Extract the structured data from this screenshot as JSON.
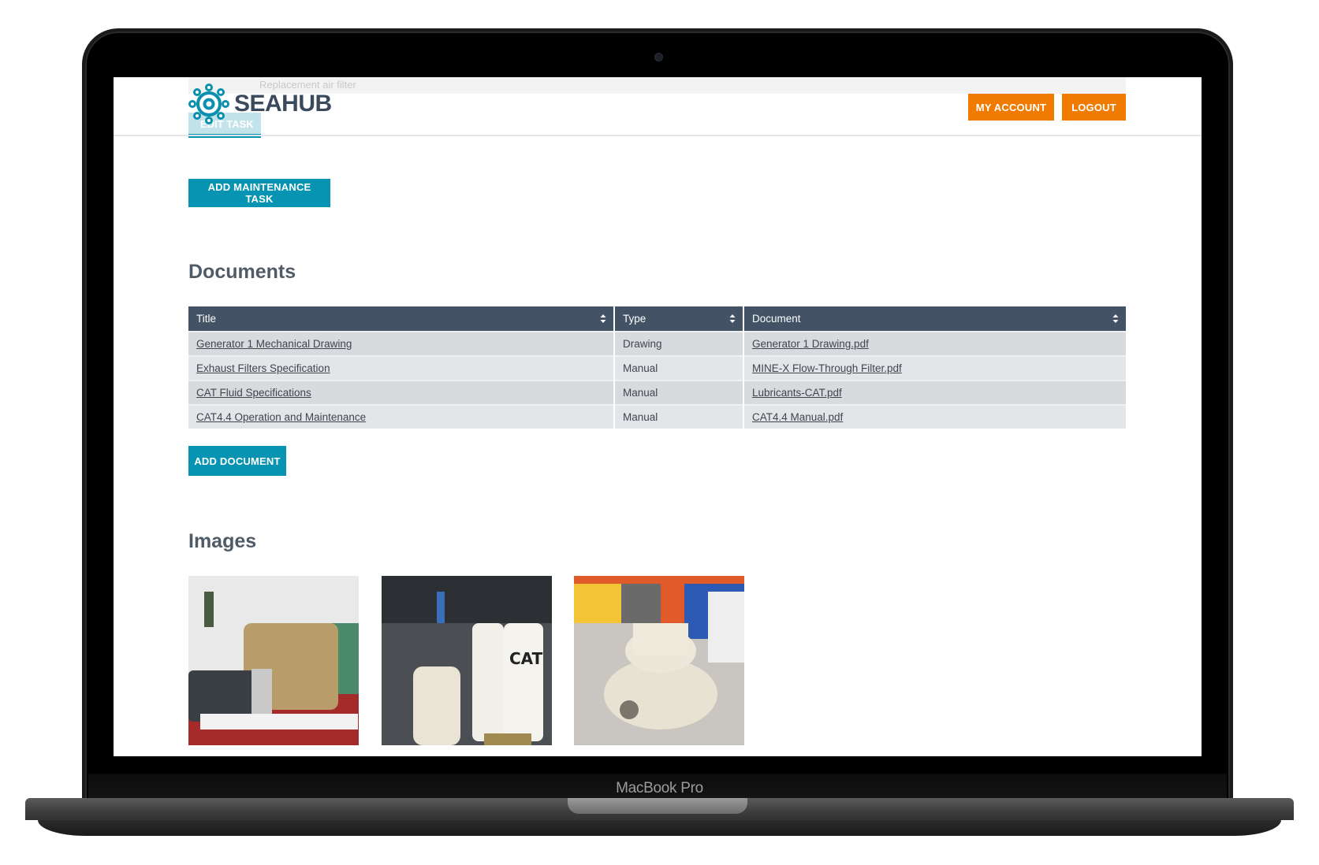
{
  "device": {
    "label": "MacBook Pro"
  },
  "header": {
    "logo_text": "SEAHUB",
    "logo_icon": "ship-wheel-icon",
    "my_account_label": "MY ACCOUNT",
    "logout_label": "LOGOUT",
    "background_peek_text": "Replacement air filter",
    "background_peek_button": "EDIT TASK"
  },
  "colors": {
    "accent_teal": "#0794b2",
    "accent_orange": "#f07b00",
    "table_header": "#435365"
  },
  "maintenance": {
    "add_task_label": "ADD MAINTENANCE TASK"
  },
  "documents": {
    "title": "Documents",
    "columns": [
      "Title",
      "Type",
      "Document"
    ],
    "sort_icon": "sort-icon",
    "rows": [
      {
        "title": "Generator 1 Mechanical Drawing",
        "type": "Drawing",
        "document": "Generator 1 Drawing.pdf"
      },
      {
        "title": "Exhaust Filters Specification",
        "type": "Manual",
        "document": "MINE-X Flow-Through Filter.pdf"
      },
      {
        "title": "CAT Fluid Specifications",
        "type": "Manual",
        "document": "Lubricants-CAT.pdf"
      },
      {
        "title": "CAT4.4 Operation and Maintenance",
        "type": "Manual",
        "document": "CAT4.4 Manual.pdf"
      }
    ],
    "add_label": "ADD DOCUMENT"
  },
  "images": {
    "title": "Images",
    "items": [
      {
        "alt": "Generator engine in engine room"
      },
      {
        "alt": "CAT fuel filters"
      },
      {
        "alt": "Water pump part"
      }
    ]
  }
}
